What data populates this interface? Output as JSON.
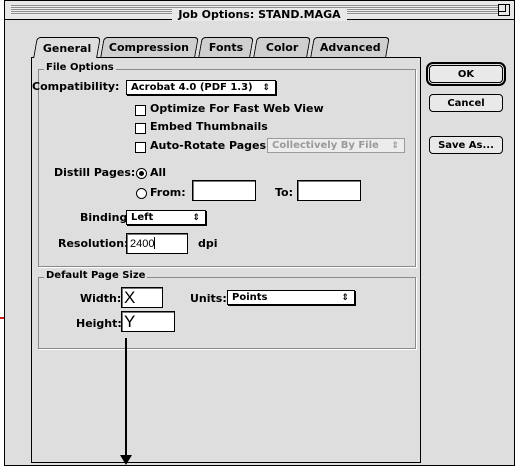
{
  "window": {
    "title": "Job Options: STAND.MAGA"
  },
  "tabs": [
    {
      "label": "General",
      "active": true
    },
    {
      "label": "Compression",
      "active": false
    },
    {
      "label": "Fonts",
      "active": false
    },
    {
      "label": "Color",
      "active": false
    },
    {
      "label": "Advanced",
      "active": false
    }
  ],
  "file_options": {
    "group_label": "File Options",
    "compatibility_label": "Compatibility:",
    "compatibility_value": "Acrobat 4.0 (PDF 1.3)",
    "optimize_label": "Optimize For Fast Web View",
    "embed_thumbnails_label": "Embed Thumbnails",
    "auto_rotate_label": "Auto-Rotate Pages:",
    "auto_rotate_value": "Collectively By File",
    "distill_label": "Distill Pages:",
    "all_label": "All",
    "from_label": "From:",
    "to_label": "To:",
    "binding_label": "Binding:",
    "binding_value": "Left",
    "resolution_label": "Resolution:",
    "resolution_value": "2400",
    "dpi_label": "dpi"
  },
  "page_size": {
    "group_label": "Default Page Size",
    "width_label": "Width:",
    "width_value": "X",
    "height_label": "Height:",
    "height_value": "Y",
    "units_label": "Units:",
    "units_value": "Points"
  },
  "buttons": {
    "ok": "OK",
    "cancel": "Cancel",
    "save_as": "Save As..."
  },
  "popup_arrows": "⇕",
  "colors": {
    "window_bg": "#dedede",
    "annotation_arrow": "#000000",
    "red_mark": "#d21c1c"
  }
}
